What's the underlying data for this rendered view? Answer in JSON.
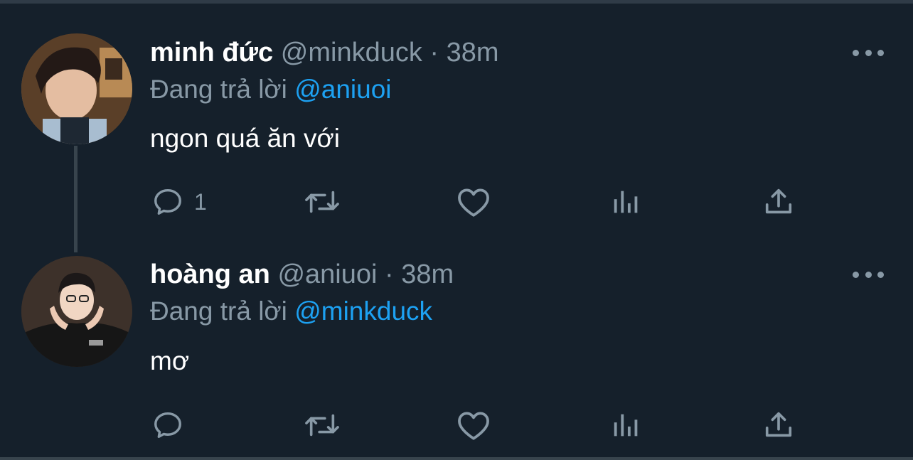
{
  "tweets": [
    {
      "name": "minh đức",
      "handle": "@minkduck",
      "separator": "·",
      "time": "38m",
      "replying_prefix": "Đang trả lời",
      "replying_to": "@aniuoi",
      "text": "ngon quá ăn với",
      "reply_count": "1"
    },
    {
      "name": "hoàng an",
      "handle": "@aniuoi",
      "separator": "·",
      "time": "38m",
      "replying_prefix": "Đang trả lời",
      "replying_to": "@minkduck",
      "text": "mơ",
      "reply_count": ""
    }
  ],
  "colors": {
    "background": "#15202b",
    "text_primary": "#ffffff",
    "text_secondary": "#8899a6",
    "accent": "#1da1f2",
    "divider": "#38444d"
  },
  "icons": [
    "reply-icon",
    "retweet-icon",
    "like-icon",
    "views-icon",
    "share-icon",
    "more-icon"
  ]
}
